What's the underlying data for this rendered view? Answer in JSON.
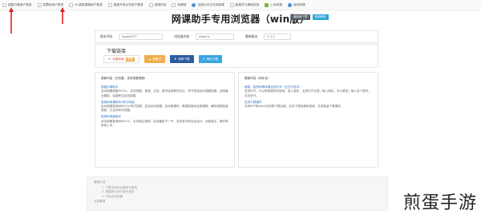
{
  "bookmarks": [
    {
      "label": "超星尔雅用户登录",
      "icon": "page-icon"
    },
    {
      "label": "智慧树用户登录",
      "icon": "page-icon"
    },
    {
      "label": "Hi 超星课程用户登录",
      "icon": "page-icon"
    },
    {
      "label": "国家开放大学用户登录",
      "icon": "page-icon"
    },
    {
      "label": "我国在线",
      "icon": "page-icon"
    },
    {
      "label": "雨课堂",
      "icon": "page-icon"
    },
    {
      "label": "全国大学生在线慕课",
      "icon": "globe-icon"
    },
    {
      "label": "超星学习通网页版",
      "icon": "page-icon"
    },
    {
      "label": "上传网课",
      "icon": "green-icon"
    },
    {
      "label": "我的网课",
      "icon": "globe-icon"
    }
  ],
  "header": {
    "title": "网课助手专用浏览器（win版）",
    "badges": [
      "最新版下载",
      "使用教程"
    ]
  },
  "info": {
    "member_label": "版本号码",
    "member_value": "wyzb0077",
    "kernel_label": "浏览器内核",
    "kernel_value": "Aobo ie",
    "version_label": "最新版本",
    "version_value": "V 1.0"
  },
  "download": {
    "title": "下载链接",
    "buttons": [
      {
        "label": "百度网盘",
        "tag": "推荐",
        "icon": "star-icon"
      },
      {
        "label": "蓝奏云",
        "icon": "cloud-icon"
      },
      {
        "label": "官网下载",
        "icon": "download-icon"
      },
      {
        "label": "网页下载",
        "icon": "link-icon"
      }
    ]
  },
  "left_desc": {
    "title": "更新内容（已完善，支持观看视频）",
    "sections": [
      {
        "heading": "超星尔雅助手",
        "text": "自动观看超星MOOC，支持视频、音频、文档、图书阅读等任务点，章节测验自动搜题答题，全网最全题库，结课考试自动答题。"
      },
      {
        "heading": "智慧树网课助手(考试专版)",
        "text": "自动观看智慧树MOOC考试答题，支持自动答题、自动刷课时，覆盖智慧树全部课程，解除视频加速限制，并支持考试答题。"
      },
      {
        "heading": "智慧树视频助手",
        "text": "自动观看智慧树MOOC，支持跳过视频、自动播放下一节，支持多开和后台运行，功能强大，操作简单易上手。"
      }
    ]
  },
  "right_desc": {
    "title": "更新内容（待补全）",
    "sections": [
      {
        "heading": "超星、智慧树等网课支持打开（正在开发中）",
        "text": "支持打开，可以帮助更好的使用，接入更多，支持打开文档；输入网址，可以登录；输入多个账号，支持多开。"
      },
      {
        "heading": "支持下载课件",
        "text": "支持PPT和Word文档等下载功能，支持下载音频和视频，支持批量下载课件。"
      }
    ]
  },
  "notes": {
    "title": "使用方法",
    "items": [
      "1. 下载安装浏览器即可使用",
      "2. 根据提示进行账号登录",
      "3. 开启自动刷课"
    ],
    "title2": "注意事项"
  },
  "watermark": "煎蛋手游"
}
